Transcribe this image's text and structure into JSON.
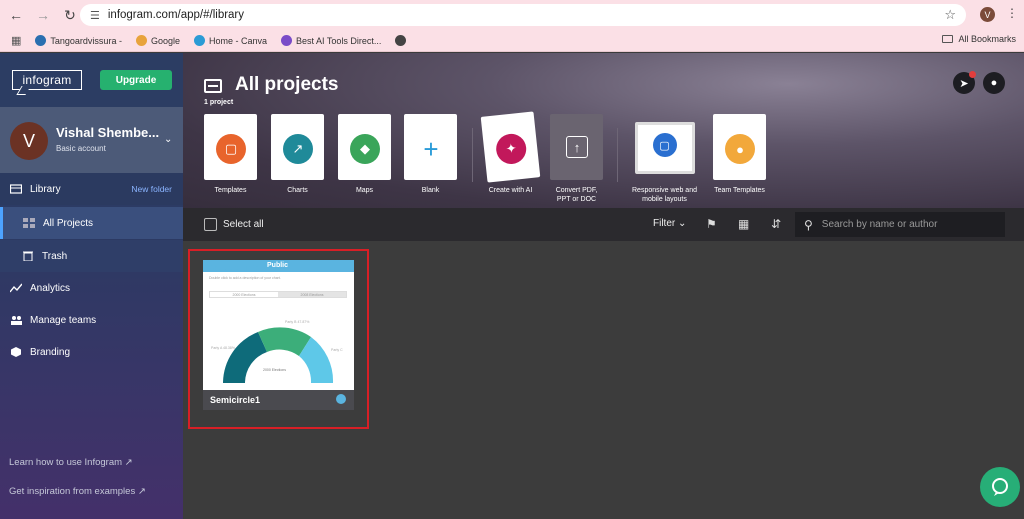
{
  "browser": {
    "url": "infogram.com/app/#/library",
    "profile_initial": "V",
    "bookmarks": [
      "Tangoardvissura -",
      "Google",
      "Home - Canva",
      "Best AI Tools Direct..."
    ],
    "all_bookmarks": "All Bookmarks"
  },
  "sidebar": {
    "logo": "infogram",
    "upgrade": "Upgrade",
    "account": {
      "initial": "V",
      "name": "Vishal Shembe...",
      "type": "Basic account"
    },
    "library": "Library",
    "new_folder": "New folder",
    "all_projects": "All Projects",
    "trash": "Trash",
    "analytics": "Analytics",
    "manage_teams": "Manage teams",
    "branding": "Branding",
    "learn": "Learn how to use Infogram",
    "inspiration": "Get inspiration from examples"
  },
  "header": {
    "title": "All projects",
    "count": "1 project",
    "tiles": [
      {
        "label": "Templates"
      },
      {
        "label": "Charts"
      },
      {
        "label": "Maps"
      },
      {
        "label": "Blank"
      },
      {
        "label": "Create with AI"
      },
      {
        "label": "Convert PDF,",
        "label2": "PPT or DOC"
      },
      {
        "label": "Responsive web and",
        "label2": "mobile layouts"
      },
      {
        "label": "Team Templates"
      }
    ]
  },
  "toolbar": {
    "select_all": "Select all",
    "filter": "Filter",
    "search_placeholder": "Search by name or author"
  },
  "project": {
    "badge": "Public",
    "heading": "Double click to edit title",
    "name": "Semicircle1",
    "subtitle": "Double click to add a description of your chart.",
    "tab1": "2000 Elections",
    "tab2": "2008 Elections",
    "center_label": "2000 Elections",
    "left_label": "Party A 48.38%",
    "top_label": "Party B 47.87%",
    "right_label": "Party C"
  },
  "colors": {
    "sidebar": "#2e3f67",
    "upgrade": "#26b16f",
    "selection": "#d81f26",
    "chart_a": "#0e6b7a",
    "chart_b": "#3cae7a",
    "chart_c": "#5ec8e8"
  }
}
